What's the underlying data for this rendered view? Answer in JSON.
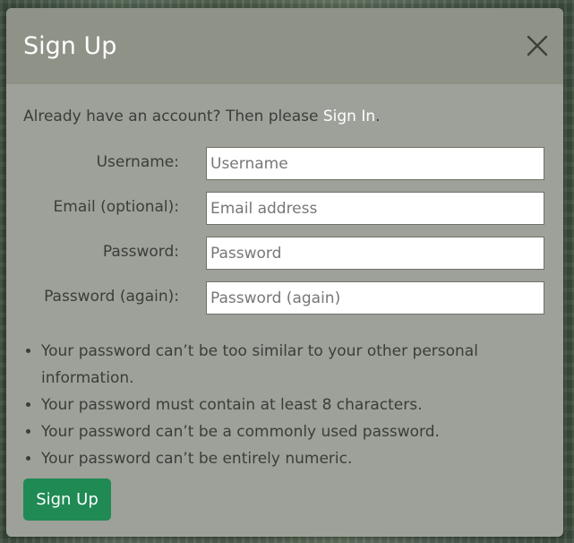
{
  "modal": {
    "title": "Sign Up",
    "close_icon": "close-icon"
  },
  "signin": {
    "prefix": "Already have an account? Then please ",
    "link_label": "Sign In",
    "suffix": "."
  },
  "form": {
    "fields": [
      {
        "label": "Username:",
        "placeholder": "Username",
        "value": ""
      },
      {
        "label": "Email (optional):",
        "placeholder": "Email address",
        "value": ""
      },
      {
        "label": "Password:",
        "placeholder": "Password",
        "value": ""
      },
      {
        "label": "Password (again):",
        "placeholder": "Password (again)",
        "value": ""
      }
    ],
    "help": [
      "Your password can’t be too similar to your other personal information.",
      "Your password must contain at least 8 characters.",
      "Your password can’t be a commonly used password.",
      "Your password can’t be entirely numeric."
    ],
    "submit_label": "Sign Up"
  },
  "colors": {
    "header_bg": "#8f9287",
    "body_bg": "#9ea199",
    "primary_button": "#1f8a54",
    "link": "#ffffff",
    "text": "#3a3e38"
  }
}
